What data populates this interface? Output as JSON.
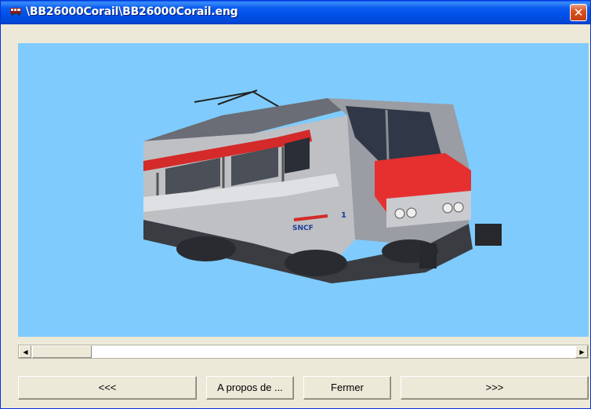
{
  "window": {
    "title": "\\BB26000Corail\\BB26000Corail.eng",
    "close_glyph": "✕",
    "app_icon": "locomotive-icon"
  },
  "viewport": {
    "background": "#7fcbfd",
    "image_label": "SNCF",
    "loco_number": "1"
  },
  "scrollbar": {
    "left_arrow": "◀",
    "right_arrow": "▶"
  },
  "buttons": {
    "prev": "<<<",
    "about": "A propos de ...",
    "close": "Fermer",
    "next": ">>>"
  }
}
